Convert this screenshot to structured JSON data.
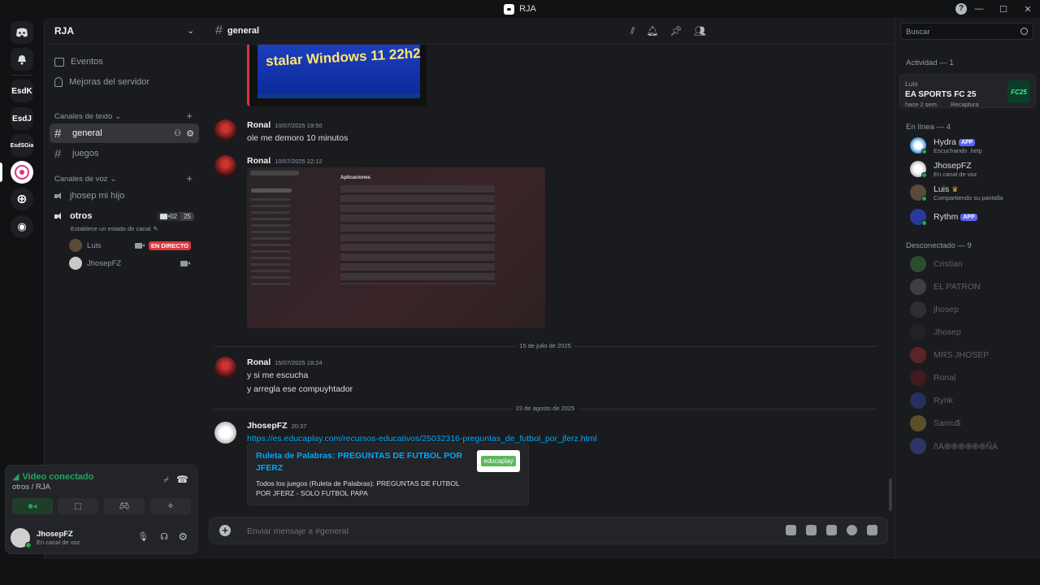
{
  "window": {
    "title": "RJA"
  },
  "server": {
    "name": "RJA"
  },
  "guilds": [
    {
      "label": "EsdK"
    },
    {
      "label": "EsdJ"
    },
    {
      "label": "EsdSGia"
    }
  ],
  "sidebar": {
    "events": "Eventos",
    "boosts": "Mejoras del servidor",
    "text_category": "Canales de texto",
    "voice_category": "Canales de voz",
    "text_channels": [
      {
        "name": "general"
      },
      {
        "name": "juegos"
      }
    ],
    "voice_channels": [
      {
        "name": "jhosep mi hijo"
      },
      {
        "name": "otros",
        "cam_count": "02",
        "user_limit": "25",
        "status": "Establece un estado de canal"
      }
    ],
    "voice_users": [
      {
        "name": "Luis",
        "live": "EN DIRECTO"
      },
      {
        "name": "JhosepFZ"
      }
    ]
  },
  "voice_panel": {
    "status": "Video conectado",
    "location": "otros / RJA"
  },
  "user": {
    "name": "JhosepFZ",
    "status": "En canal de voz"
  },
  "channel": {
    "name": "general"
  },
  "messages": [
    {
      "author": "Ronal",
      "time": "10/07/2025 19:50",
      "text": "ole me demoro 10 minutos"
    },
    {
      "author": "Ronal",
      "time": "10/07/2025 22:12"
    },
    {
      "author": "Ronal",
      "time": "15/07/2025 18:24",
      "lines": [
        "y si me escucha",
        "y arregla ese compuyhtador"
      ]
    },
    {
      "author": "JhosepFZ",
      "time": "20:37",
      "link": "https://es.educaplay.com/recursos-educativos/25032316-preguntas_de_futbol_por_jferz.html"
    }
  ],
  "top_image_text": "stalar Windows 11 22h2",
  "screenshot_panel": {
    "heading": "Aplicaciones"
  },
  "dividers": [
    "15 de julio de 2025",
    "23 de agosto de 2025"
  ],
  "embed": {
    "title": "Ruleta de Palabras: PREGUNTAS DE FUTBOL POR JFERZ",
    "description": "Todos los juegos (Ruleta de Palabras): PREGUNTAS DE FUTBOL POR JFERZ - SOLO FUTBOL PAPA",
    "thumb": "educaplay"
  },
  "composer": {
    "placeholder": "Enviar mensaje a #general"
  },
  "members_panel": {
    "search_placeholder": "Buscar",
    "activity_header": "Actividad — 1",
    "activity": {
      "user": "Luis",
      "game": "EA SPORTS FC 25",
      "time": "hace 2 sem.",
      "action": "Recaptura",
      "badge": "FC25"
    },
    "online_header": "En línea — 4",
    "online": [
      {
        "name": "Hydra",
        "badge": "APP",
        "status": "Escuchando .help"
      },
      {
        "name": "JhosepFZ",
        "status": "En canal de voz"
      },
      {
        "name": "Luis",
        "status": "Compartiendo su pantalla"
      },
      {
        "name": "Rythm",
        "badge": "APP"
      }
    ],
    "offline_header": "Desconectado — 9",
    "offline": [
      {
        "name": "Cristian"
      },
      {
        "name": "EL PATRON"
      },
      {
        "name": "jhosep"
      },
      {
        "name": "Jhosep"
      },
      {
        "name": "MRS JHOSEP"
      },
      {
        "name": "Ronal"
      },
      {
        "name": "Rynk"
      },
      {
        "name": "Samu$"
      },
      {
        "name": "ñÁ֍֍֍֍֍֍ÑÁ"
      }
    ]
  }
}
